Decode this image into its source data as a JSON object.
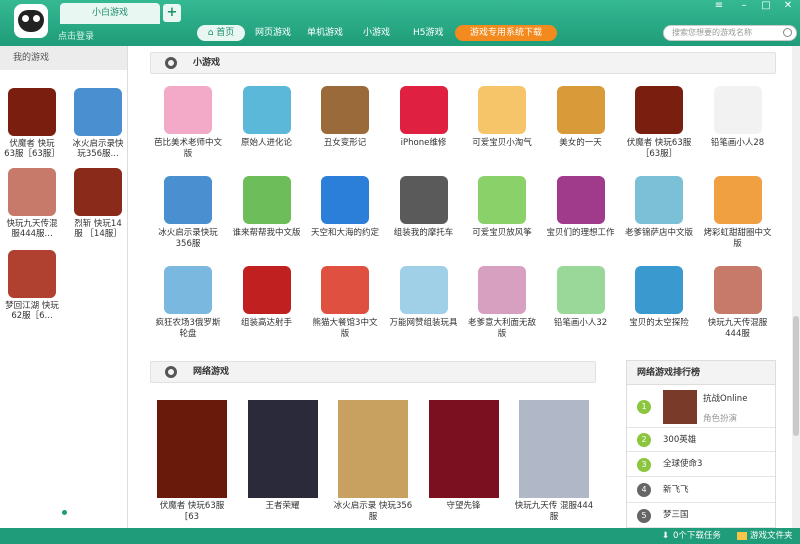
{
  "titlebar": {
    "tab": "小白游戏",
    "login": "点击登录",
    "nav": [
      "首页",
      "网页游戏",
      "单机游戏",
      "小游戏",
      "H5游戏"
    ],
    "download": "游戏专用系统下载",
    "search_placeholder": "搜索您想要的游戏名称"
  },
  "sidebar": {
    "title": "我的游戏",
    "items": [
      {
        "label": "伏魔者 快玩63服［63服］",
        "color": "#7a1e10"
      },
      {
        "label": "冰火启示录快玩356服...",
        "color": "#4a8fd0"
      },
      {
        "label": "快玩九天传混服444服...",
        "color": "#c77a6a"
      },
      {
        "label": "烈斩 快玩14服 ［14服］",
        "color": "#8a2a1a"
      },
      {
        "label": "梦回江湖 快玩62服［6...",
        "color": "#b04030"
      }
    ]
  },
  "sections": {
    "small": "小游戏",
    "online": "网络游戏"
  },
  "small_games": [
    {
      "label": "芭比美术老师中文版",
      "color": "#f3a9c8"
    },
    {
      "label": "原始人进化论",
      "color": "#5bb8d8"
    },
    {
      "label": "丑女变形记",
      "color": "#9a6a3a"
    },
    {
      "label": "iPhone维修",
      "color": "#e02040"
    },
    {
      "label": "可爱宝贝小淘气",
      "color": "#f6c56a"
    },
    {
      "label": "美女的一天",
      "color": "#d99a3a"
    },
    {
      "label": "伏魔者 快玩63服［63服］",
      "color": "#7a1e10"
    },
    {
      "label": "铅笔画小人28",
      "color": "#f2f2f2"
    },
    {
      "label": "冰火启示录快玩356服",
      "color": "#4a8fd0"
    },
    {
      "label": "谁来帮帮我中文版",
      "color": "#6dbd5a"
    },
    {
      "label": "天空和大海的约定",
      "color": "#2c7fd8"
    },
    {
      "label": "组装我的摩托车",
      "color": "#5a5a5a"
    },
    {
      "label": "可爱宝贝放风筝",
      "color": "#8bd16a"
    },
    {
      "label": "宝贝们的理想工作",
      "color": "#a03a8a"
    },
    {
      "label": "老爹锦萨店中文版",
      "color": "#7cc0d8"
    },
    {
      "label": "烤彩虹甜甜圈中文版",
      "color": "#f0a040"
    },
    {
      "label": "疯狂农场3俄罗斯轮盘",
      "color": "#7ab8e0"
    },
    {
      "label": "组装高达射手",
      "color": "#c02020"
    },
    {
      "label": "熊猫大餐馆3中文版",
      "color": "#e05040"
    },
    {
      "label": "万能网赞组装玩具",
      "color": "#9fd0e8"
    },
    {
      "label": "老爹意大利面无敌版",
      "color": "#d8a0c0"
    },
    {
      "label": "铅笔画小人32",
      "color": "#9ad89a"
    },
    {
      "label": "宝贝的太空探险",
      "color": "#3a9ad0"
    },
    {
      "label": "快玩九天传混服444服",
      "color": "#c77a6a"
    }
  ],
  "online_games": [
    {
      "label": "伏魔者 快玩63服 [63",
      "color": "#6a1a0a"
    },
    {
      "label": "王者荣耀",
      "color": "#2a2a3a"
    },
    {
      "label": "冰火启示录 快玩356服",
      "color": "#c8a060"
    },
    {
      "label": "守望先锋",
      "color": "#7a1020"
    },
    {
      "label": "快玩九天传 混服444服",
      "color": "#b0b8c8"
    }
  ],
  "ranking": {
    "title": "网络游戏排行榜",
    "items": [
      {
        "num": "1",
        "name": "抗战Online",
        "sub": "角色扮演"
      },
      {
        "num": "2",
        "name": "300英雄"
      },
      {
        "num": "3",
        "name": "全球使命3"
      },
      {
        "num": "4",
        "name": "新飞飞"
      },
      {
        "num": "5",
        "name": "梦三国"
      }
    ]
  },
  "status": {
    "downloads": "0个下载任务",
    "folder": "游戏文件夹"
  },
  "colors": {
    "brand": "#1f9c79",
    "accent": "#f38a1e"
  }
}
